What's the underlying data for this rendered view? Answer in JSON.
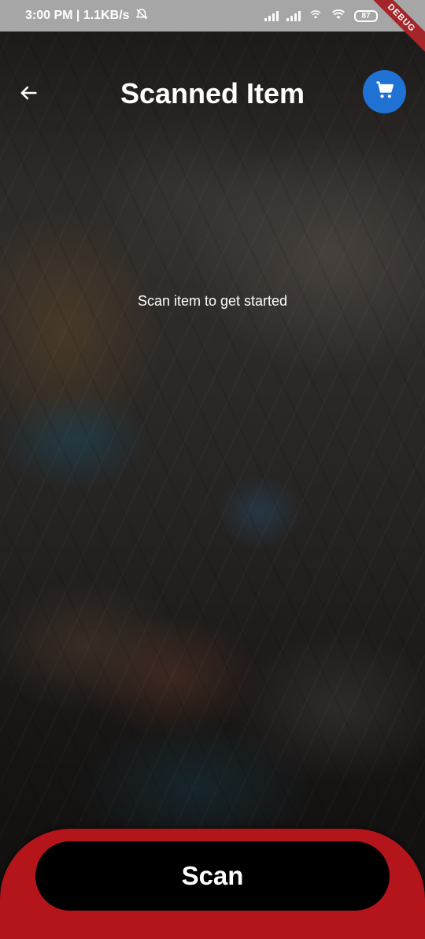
{
  "status_bar": {
    "time_and_speed": "3:00 PM | 1.1KB/s",
    "battery_level": "87",
    "debug_banner": "DEBUG"
  },
  "app_bar": {
    "title": "Scanned Item",
    "back_icon": "arrow-left-icon",
    "cart_icon": "shopping-cart-icon",
    "cart_button_color": "#1f72d4"
  },
  "content": {
    "empty_message": "Scan item to get started"
  },
  "bottom": {
    "scan_label": "Scan",
    "panel_color": "#b4151b",
    "button_color": "#000000"
  }
}
